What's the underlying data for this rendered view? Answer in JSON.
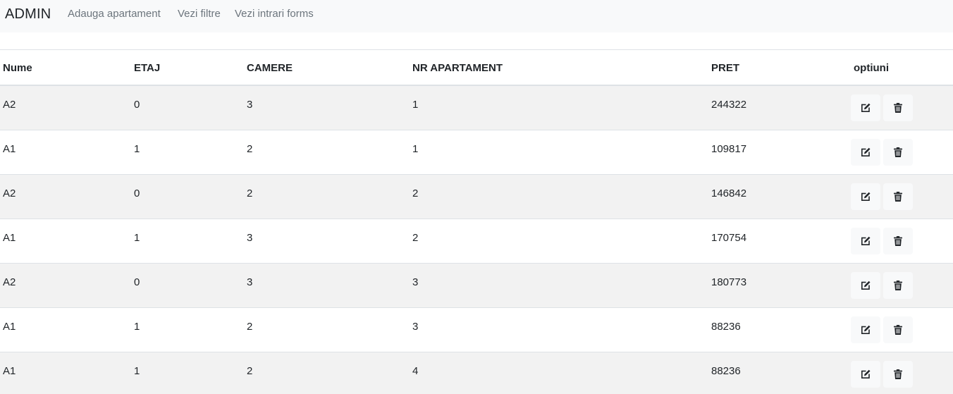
{
  "navbar": {
    "brand": "ADMIN",
    "links": [
      "Adauga apartament",
      "Vezi filtre",
      "Vezi intrari forms"
    ]
  },
  "table": {
    "headers": [
      "Nume",
      "ETAJ",
      "CAMERE",
      "NR APARTAMENT",
      "PRET",
      "optiuni"
    ],
    "rows": [
      [
        "A2",
        "0",
        "3",
        "1",
        "244322"
      ],
      [
        "A1",
        "1",
        "2",
        "1",
        "109817"
      ],
      [
        "A2",
        "0",
        "2",
        "2",
        "146842"
      ],
      [
        "A1",
        "1",
        "3",
        "2",
        "170754"
      ],
      [
        "A2",
        "0",
        "3",
        "3",
        "180773"
      ],
      [
        "A1",
        "1",
        "2",
        "3",
        "88236"
      ],
      [
        "A1",
        "1",
        "2",
        "4",
        "88236"
      ]
    ]
  },
  "icons": {
    "edit": "edit-icon",
    "delete": "trash-icon"
  }
}
